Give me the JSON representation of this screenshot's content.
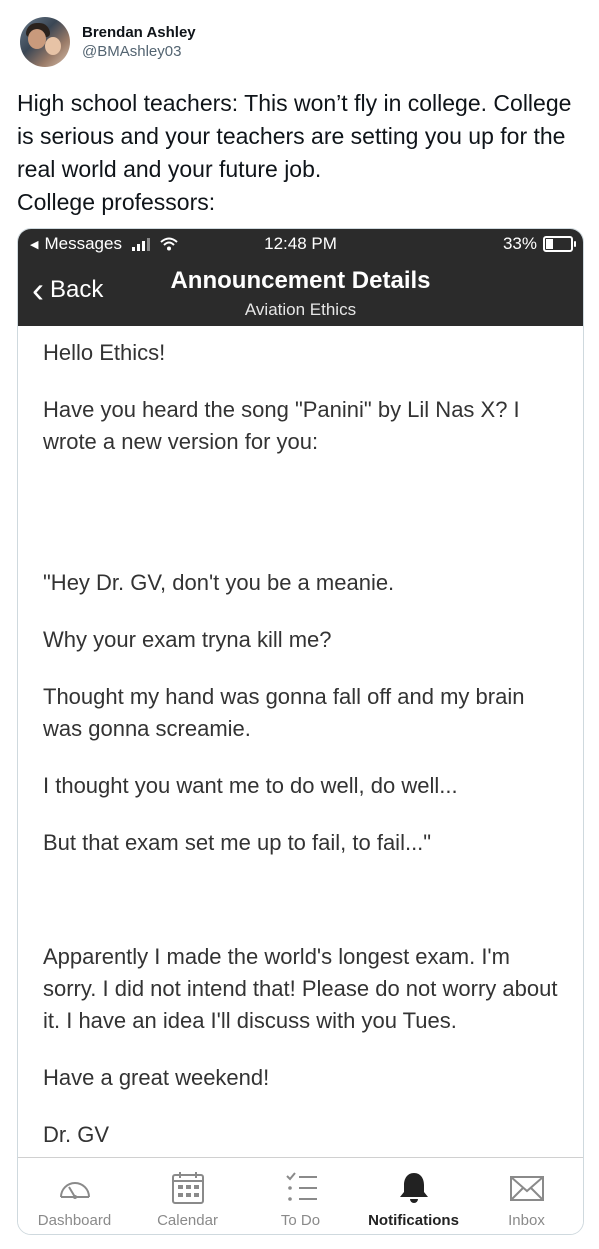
{
  "tweet": {
    "display_name": "Brendan Ashley",
    "handle": "@BMAshley03",
    "text": "High school teachers: This won’t fly in college. College is serious and your teachers are setting you up for the real world and your future job.\nCollege professors:"
  },
  "statusbar": {
    "back_app": "Messages",
    "time": "12:48 PM",
    "battery": "33%",
    "battery_level": 0.33
  },
  "navbar": {
    "back_label": "Back",
    "title": "Announcement Details",
    "subtitle": "Aviation Ethics"
  },
  "announcement": {
    "p1": "Hello Ethics!",
    "p2": "Have you heard the song \"Panini\" by Lil Nas X? I wrote a new version for you:",
    "p3": "\"Hey Dr. GV, don't you be a meanie.",
    "p4": "Why your exam tryna kill me?",
    "p5": "Thought my hand was gonna fall off and my brain was gonna screamie.",
    "p6": "I thought you want me to do well, do well...",
    "p7": "But that exam set me up to fail, to fail...\"",
    "p8": "Apparently I made the world's longest exam. I'm sorry. I did not intend that! Please do not worry about it. I have an idea I'll discuss with you Tues.",
    "p9": "Have a great weekend!",
    "p10": "Dr. GV"
  },
  "tabbar": {
    "items": [
      {
        "label": "Dashboard",
        "icon": "dashboard-icon"
      },
      {
        "label": "Calendar",
        "icon": "calendar-icon"
      },
      {
        "label": "To Do",
        "icon": "todo-icon"
      },
      {
        "label": "Notifications",
        "icon": "bell-icon",
        "active": true
      },
      {
        "label": "Inbox",
        "icon": "inbox-icon"
      }
    ]
  },
  "colors": {
    "bar_background": "#2b2b2b",
    "tab_inactive": "#8a8a8a",
    "tab_active": "#222222"
  }
}
